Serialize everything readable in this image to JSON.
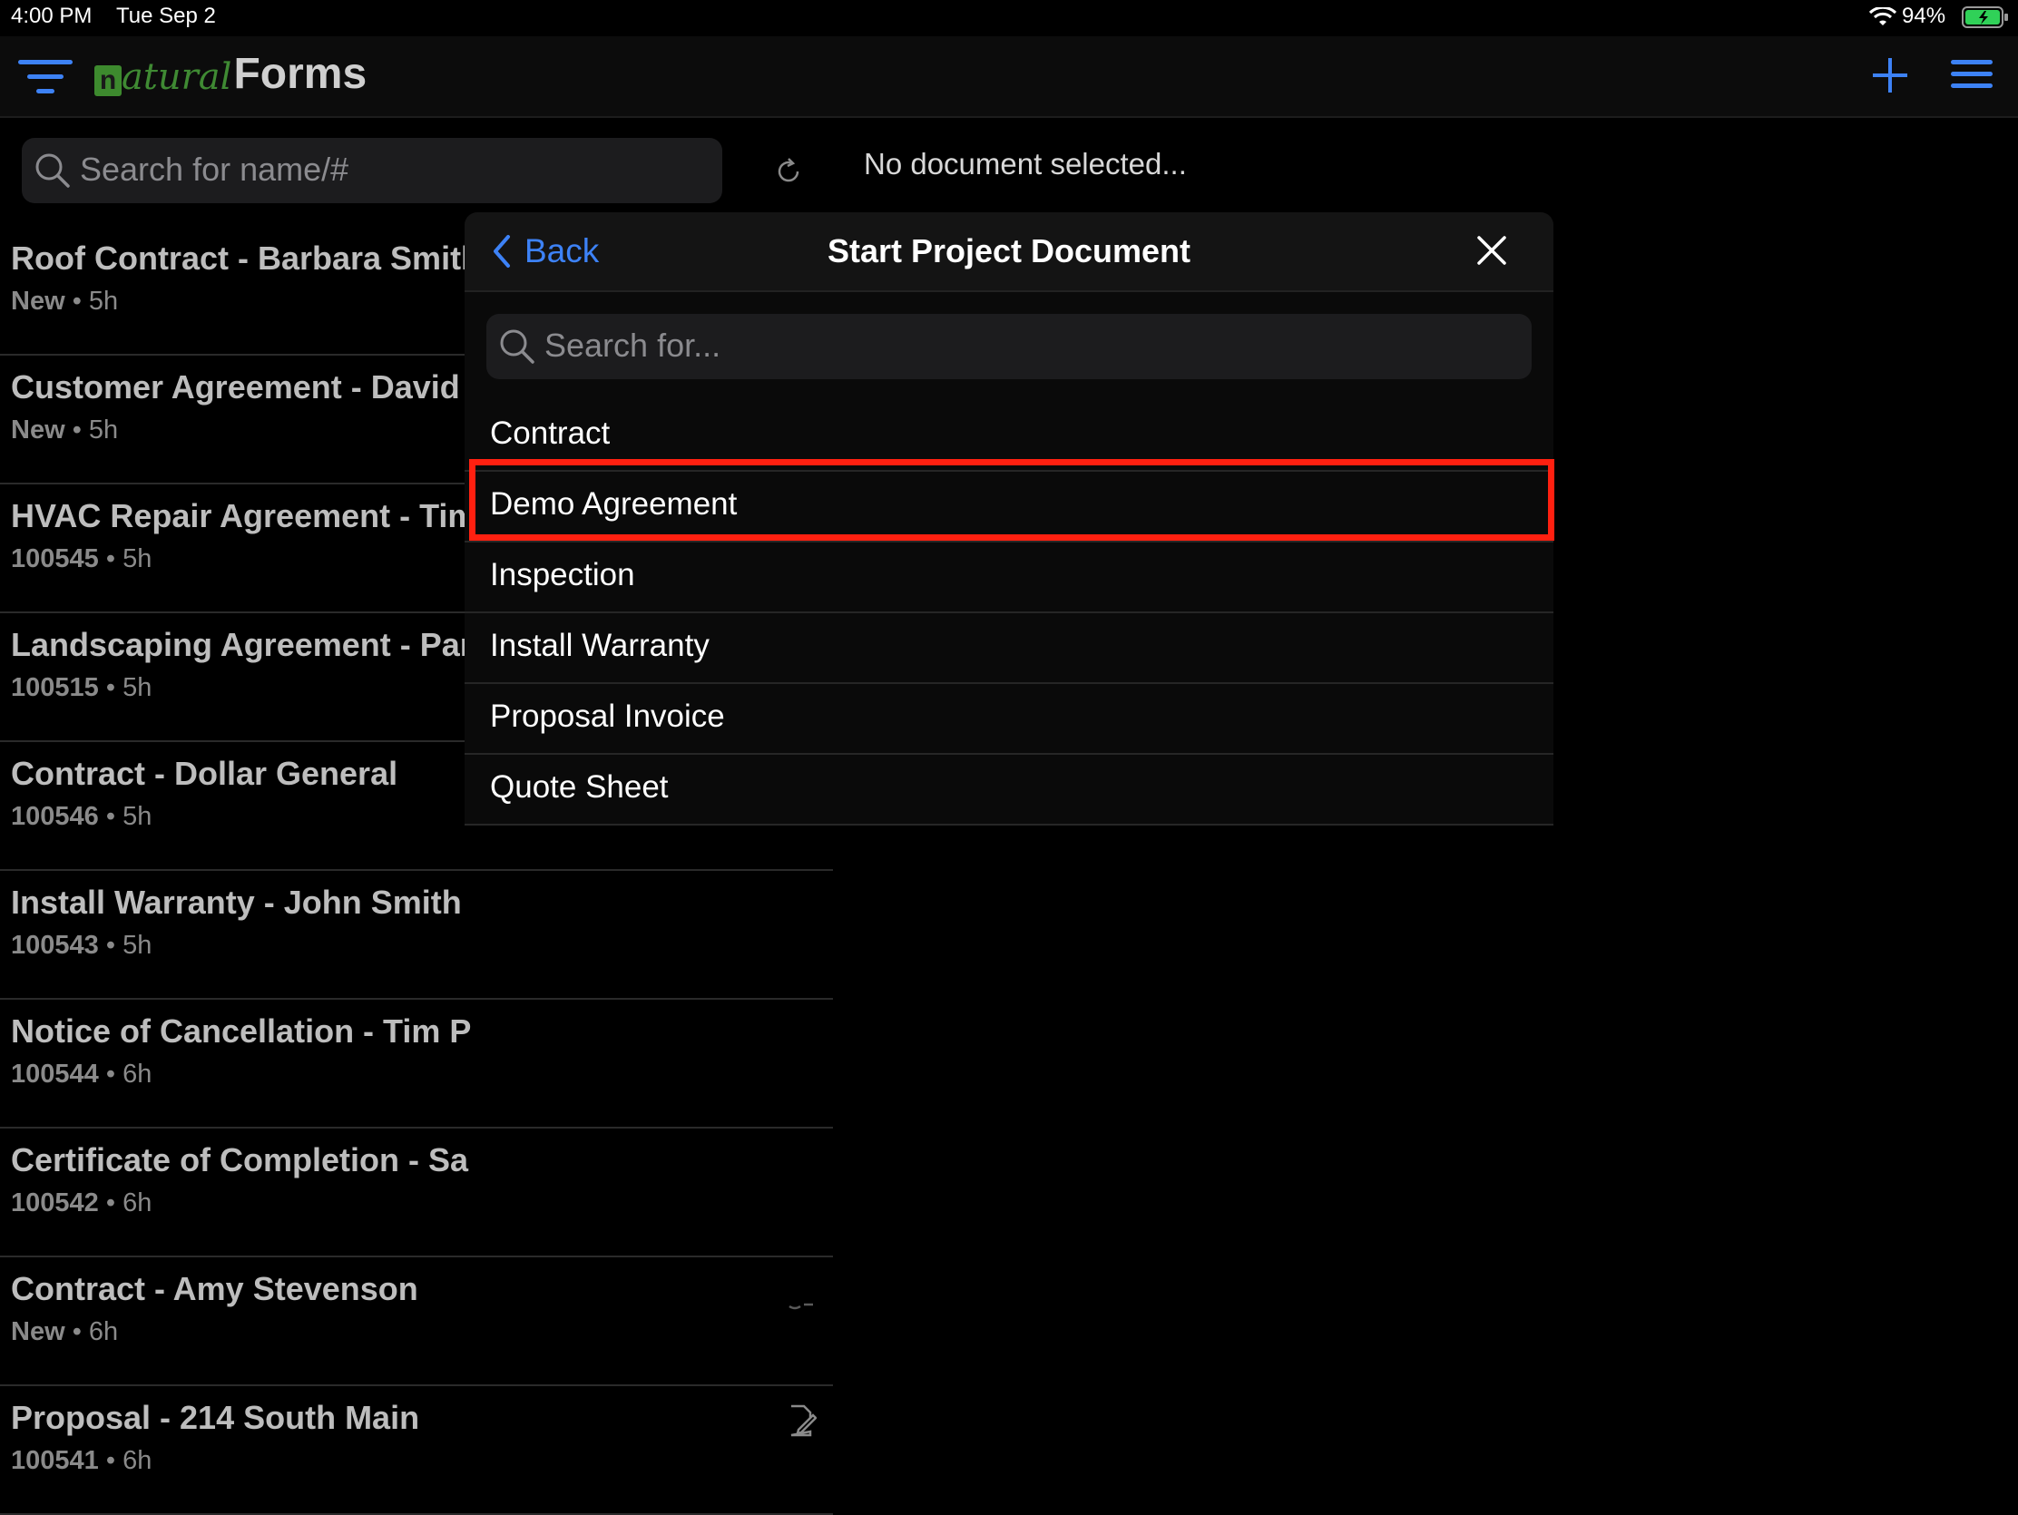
{
  "status_bar": {
    "time": "4:00 PM",
    "date": "Tue Sep 2",
    "battery": "94%"
  },
  "app": {
    "logo_n": "n",
    "logo_natural": "atural",
    "logo_forms": "Forms"
  },
  "search": {
    "placeholder": "Search for name/#"
  },
  "detail": {
    "empty_text": "No document selected..."
  },
  "documents": [
    {
      "title": "Roof Contract - Barbara Smith",
      "id": "New",
      "age": "5h"
    },
    {
      "title": "Customer Agreement - David",
      "id": "New",
      "age": "5h"
    },
    {
      "title": "HVAC Repair Agreement - Tim",
      "id": "100545",
      "age": "5h"
    },
    {
      "title": "Landscaping Agreement - Par",
      "id": "100515",
      "age": "5h"
    },
    {
      "title": "Contract - Dollar General",
      "id": "100546",
      "age": "5h"
    },
    {
      "title": "Install Warranty - John Smith",
      "id": "100543",
      "age": "5h"
    },
    {
      "title": "Notice of Cancellation - Tim P",
      "id": "100544",
      "age": "6h"
    },
    {
      "title": "Certificate of Completion - Sa",
      "id": "100542",
      "age": "6h"
    },
    {
      "title": "Contract - Amy Stevenson",
      "id": "New",
      "age": "6h"
    },
    {
      "title": "Proposal - 214 South Main",
      "id": "100541",
      "age": "6h"
    }
  ],
  "separator": "•",
  "modal": {
    "back_label": "Back",
    "title": "Start Project Document",
    "search_placeholder": "Search for...",
    "options": [
      "Contract",
      "Demo Agreement",
      "Inspection",
      "Install Warranty",
      "Proposal Invoice",
      "Quote Sheet"
    ],
    "highlighted": "Demo Agreement"
  },
  "colors": {
    "accent": "#3d82f6",
    "highlight": "#ff2010",
    "brand_green": "#3f8a33"
  }
}
